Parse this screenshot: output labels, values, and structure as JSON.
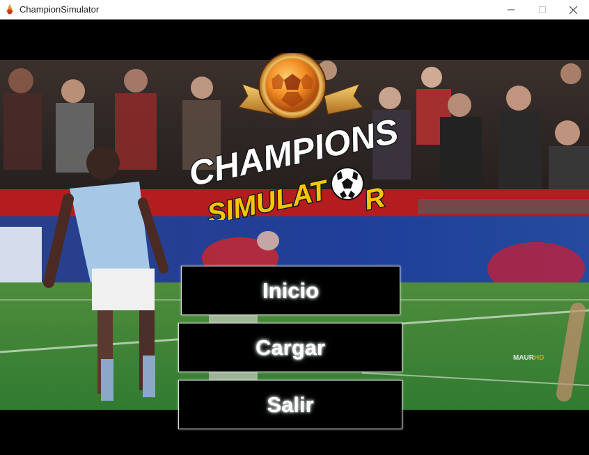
{
  "window": {
    "title": "ChampionSimulator",
    "minimize_icon": "minimize-icon",
    "maximize_icon": "maximize-icon",
    "close_icon": "close-icon"
  },
  "logo": {
    "line1": "CHAMPIONS",
    "line2": "SIMULAT",
    "line2_end": "R"
  },
  "menu": {
    "inicio_label": "Inicio",
    "cargar_label": "Cargar",
    "salir_label": "Salir"
  },
  "watermark": {
    "text_left": "MAUR",
    "text_right": "HD"
  },
  "colors": {
    "logo_white": "#ffffff",
    "logo_yellow": "#f7c600",
    "gold": "#d9a13a",
    "pitch": "#3f8a3a",
    "button_bg": "#000000"
  }
}
